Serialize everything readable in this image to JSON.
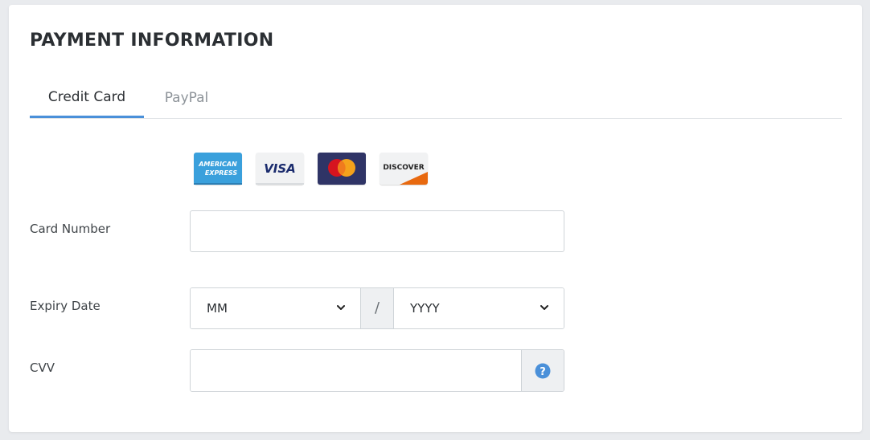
{
  "title": "PAYMENT INFORMATION",
  "tabs": [
    {
      "label": "Credit Card",
      "active": true
    },
    {
      "label": "PayPal",
      "active": false
    }
  ],
  "card_logos": [
    {
      "name": "american-express",
      "text": "AMERICAN EXPRESS"
    },
    {
      "name": "visa",
      "text": "VISA"
    },
    {
      "name": "mastercard",
      "text": ""
    },
    {
      "name": "discover",
      "text": "DISCOVER"
    }
  ],
  "form": {
    "card_number": {
      "label": "Card Number",
      "value": ""
    },
    "expiry": {
      "label": "Expiry Date",
      "month_selected": "MM",
      "separator": "/",
      "year_selected": "YYYY"
    },
    "cvv": {
      "label": "CVV",
      "value": ""
    }
  },
  "colors": {
    "accent": "#4a90d9",
    "help_icon": "#4a90d9"
  }
}
